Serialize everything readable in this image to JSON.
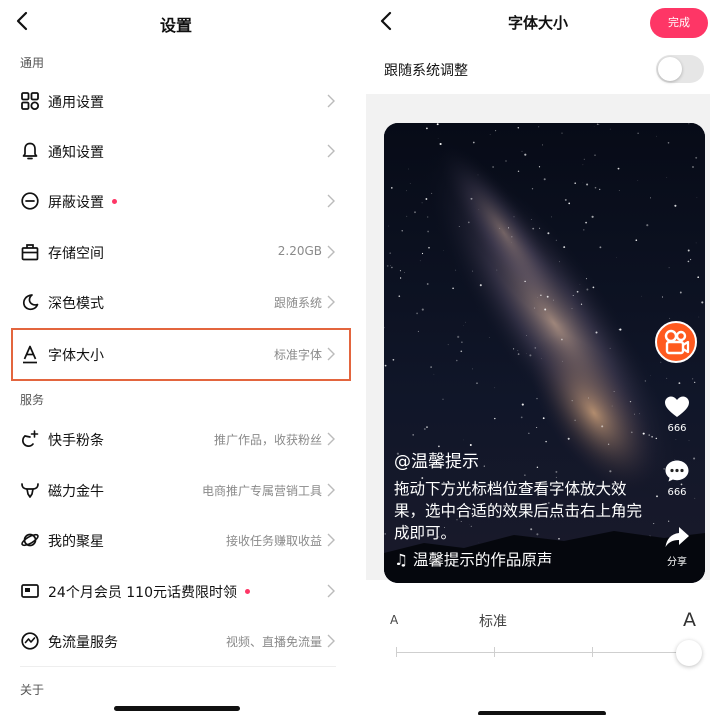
{
  "left": {
    "title": "设置",
    "sections": {
      "general": "通用",
      "service": "服务",
      "about": "关于"
    },
    "items": [
      {
        "label": "通用设置",
        "value": "",
        "icon": "grid-icon"
      },
      {
        "label": "通知设置",
        "value": "",
        "icon": "bell-icon"
      },
      {
        "label": "屏蔽设置",
        "value": "",
        "icon": "block-icon",
        "dot": true
      },
      {
        "label": "存储空间",
        "value": "2.20GB",
        "icon": "storage-box-icon"
      },
      {
        "label": "深色模式",
        "value": "跟随系统",
        "icon": "moon-icon"
      },
      {
        "label": "字体大小",
        "value": "标准字体",
        "icon": "font-a-icon",
        "highlighted": true
      },
      {
        "label": "快手粉条",
        "value": "推广作品，收获粉丝",
        "icon": "promote-icon"
      },
      {
        "label": "磁力金牛",
        "value": "电商推广专属营销工具",
        "icon": "bull-icon"
      },
      {
        "label": "我的聚星",
        "value": "接收任务赚取收益",
        "icon": "planet-icon"
      },
      {
        "label": "24个月会员 110元话费限时领",
        "value": "",
        "icon": "card-icon",
        "dot": true
      },
      {
        "label": "免流量服务",
        "value": "视频、直播免流量",
        "icon": "data-free-icon"
      }
    ]
  },
  "right": {
    "title": "字体大小",
    "done_label": "完成",
    "follow_system_label": "跟随系统调整",
    "follow_system_on": false,
    "preview": {
      "username": "@温馨提示",
      "text": "拖动下方光标档位查看字体放大效果，选中合适的效果后点击右上角完成即可。",
      "music": "♫ 温馨提示的作品原声",
      "likes": "666",
      "comments": "666",
      "share": "分享"
    },
    "slider": {
      "small_label": "A",
      "standard_label": "标准",
      "large_label": "A",
      "levels": 4,
      "selected_level": 4
    }
  },
  "colors": {
    "accent": "#fe3666",
    "highlight_border": "#e3653e",
    "live_badge": "#ff5a1f"
  }
}
